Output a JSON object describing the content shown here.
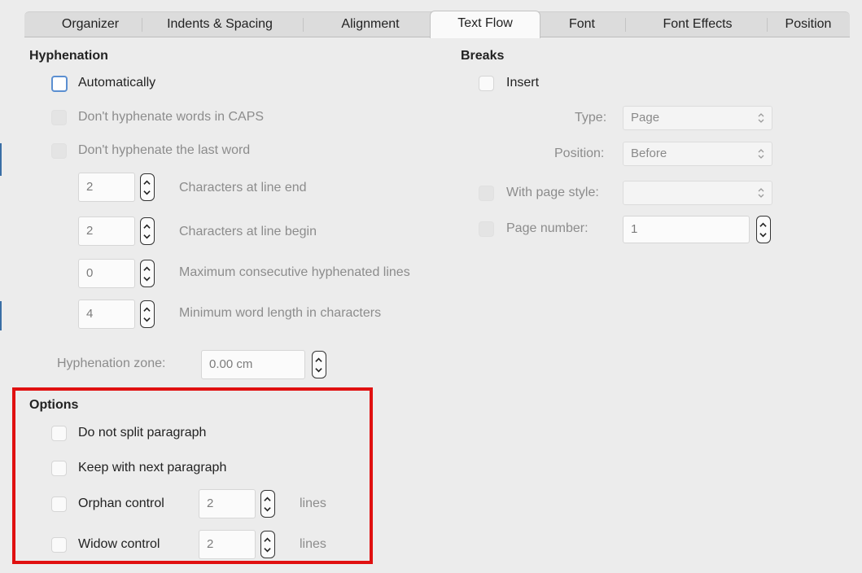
{
  "tabs": {
    "organizer": "Organizer",
    "indents": "Indents & Spacing",
    "alignment": "Alignment",
    "text_flow": "Text Flow",
    "font": "Font",
    "font_effects": "Font Effects",
    "position": "Position"
  },
  "hyphenation": {
    "heading": "Hyphenation",
    "automatically": "Automatically",
    "no_caps": "Don't hyphenate words in CAPS",
    "no_last_word": "Don't hyphenate the last word",
    "chars_line_end_value": "2",
    "chars_line_end_label": "Characters at line end",
    "chars_line_begin_value": "2",
    "chars_line_begin_label": "Characters at line begin",
    "max_consec_value": "0",
    "max_consec_label": "Maximum consecutive hyphenated lines",
    "min_word_value": "4",
    "min_word_label": "Minimum word length in characters",
    "zone_label": "Hyphenation zone:",
    "zone_value": "0.00 cm"
  },
  "breaks": {
    "heading": "Breaks",
    "insert": "Insert",
    "type_label": "Type:",
    "type_value": "Page",
    "position_label": "Position:",
    "position_value": "Before",
    "page_style_label": "With page style:",
    "page_style_value": "",
    "page_number_label": "Page number:",
    "page_number_value": "1"
  },
  "options": {
    "heading": "Options",
    "no_split": "Do not split paragraph",
    "keep_next": "Keep with next paragraph",
    "orphan_label": "Orphan control",
    "orphan_value": "2",
    "orphan_unit": "lines",
    "widow_label": "Widow control",
    "widow_value": "2",
    "widow_unit": "lines"
  },
  "colors": {
    "highlight": "#e01010",
    "focus": "#5b8fd1"
  }
}
